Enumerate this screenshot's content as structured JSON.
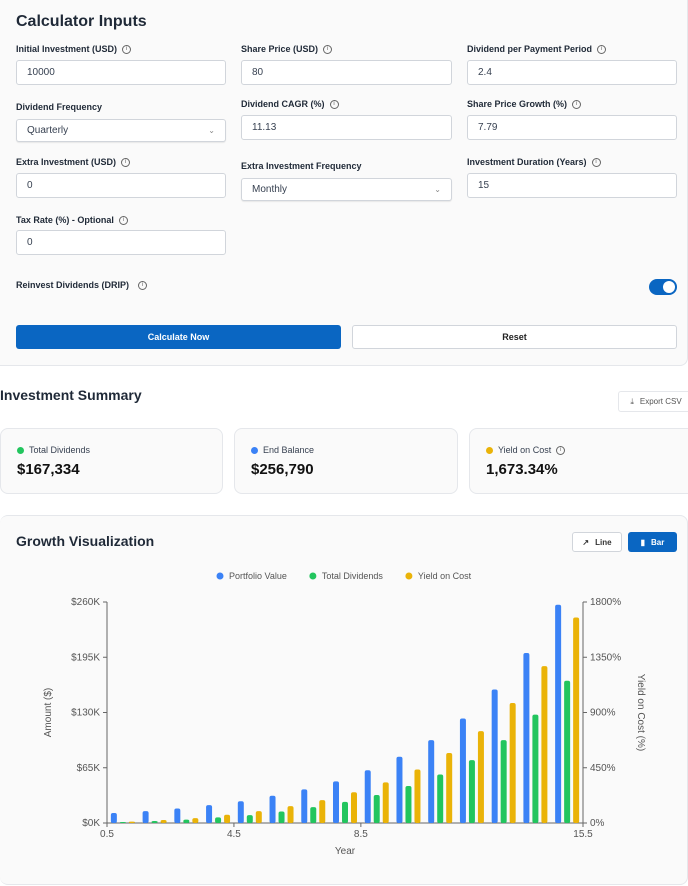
{
  "inputs": {
    "title": "Calculator Inputs",
    "initial_investment": {
      "label": "Initial Investment (USD)",
      "value": "10000"
    },
    "share_price": {
      "label": "Share Price (USD)",
      "value": "80"
    },
    "dividend_per_period": {
      "label": "Dividend per Payment Period",
      "value": "2.4"
    },
    "dividend_frequency": {
      "label": "Dividend Frequency",
      "value": "Quarterly"
    },
    "dividend_cagr": {
      "label": "Dividend CAGR (%)",
      "value": "11.13"
    },
    "share_price_growth": {
      "label": "Share Price Growth (%)",
      "value": "7.79"
    },
    "extra_investment": {
      "label": "Extra Investment (USD)",
      "value": "0"
    },
    "extra_frequency": {
      "label": "Extra Investment Frequency",
      "value": "Monthly"
    },
    "duration": {
      "label": "Investment Duration (Years)",
      "value": "15"
    },
    "tax_rate": {
      "label": "Tax Rate (%) - Optional",
      "value": "0"
    },
    "drip": {
      "label": "Reinvest Dividends (DRIP)",
      "enabled": true
    },
    "calculate_label": "Calculate Now",
    "reset_label": "Reset"
  },
  "summary": {
    "title": "Investment Summary",
    "export_label": "Export CSV",
    "cards": [
      {
        "label": "Total Dividends",
        "value": "$167,334",
        "color": "#22c55e"
      },
      {
        "label": "End Balance",
        "value": "$256,790",
        "color": "#3b82f6"
      },
      {
        "label": "Yield on Cost",
        "value": "1,673.34%",
        "color": "#eab308"
      }
    ]
  },
  "growth": {
    "title": "Growth Visualization",
    "line_label": "Line",
    "bar_label": "Bar",
    "active_view": "Bar"
  },
  "chart_data": {
    "type": "bar",
    "xlabel": "Year",
    "ylabel": "Amount ($)",
    "y2label": "Yield on Cost (%)",
    "xlim": [
      0.5,
      15.5
    ],
    "ylim": [
      0,
      260000
    ],
    "y2lim": [
      0,
      1800
    ],
    "xticks": [
      "0.5",
      "4.5",
      "8.5",
      "15.5"
    ],
    "yticks": [
      "$0K",
      "$65K",
      "$130K",
      "$195K",
      "$260K"
    ],
    "y2ticks": [
      "0%",
      "450%",
      "900%",
      "1350%",
      "1800%"
    ],
    "legend_position": "top",
    "x": [
      1,
      2,
      3,
      4,
      5,
      6,
      7,
      8,
      9,
      10,
      11,
      12,
      13,
      14,
      15
    ],
    "series": [
      {
        "name": "Portfolio Value",
        "color": "#3b82f6",
        "axis": "left",
        "values": [
          11700,
          14000,
          17000,
          21000,
          25600,
          32000,
          39600,
          49000,
          62000,
          78000,
          97500,
          123000,
          157000,
          200000,
          256790
        ]
      },
      {
        "name": "Total Dividends",
        "color": "#22c55e",
        "axis": "left",
        "values": [
          1200,
          2300,
          3900,
          6600,
          9300,
          13600,
          18700,
          24900,
          33000,
          43500,
          57000,
          74000,
          97500,
          127500,
          167334
        ]
      },
      {
        "name": "Yield on Cost",
        "color": "#eab308",
        "axis": "right",
        "values": [
          11,
          24,
          40,
          67,
          97,
          137,
          186,
          250,
          331,
          436,
          570,
          748,
          977,
          1278,
          1673.34
        ]
      }
    ]
  }
}
